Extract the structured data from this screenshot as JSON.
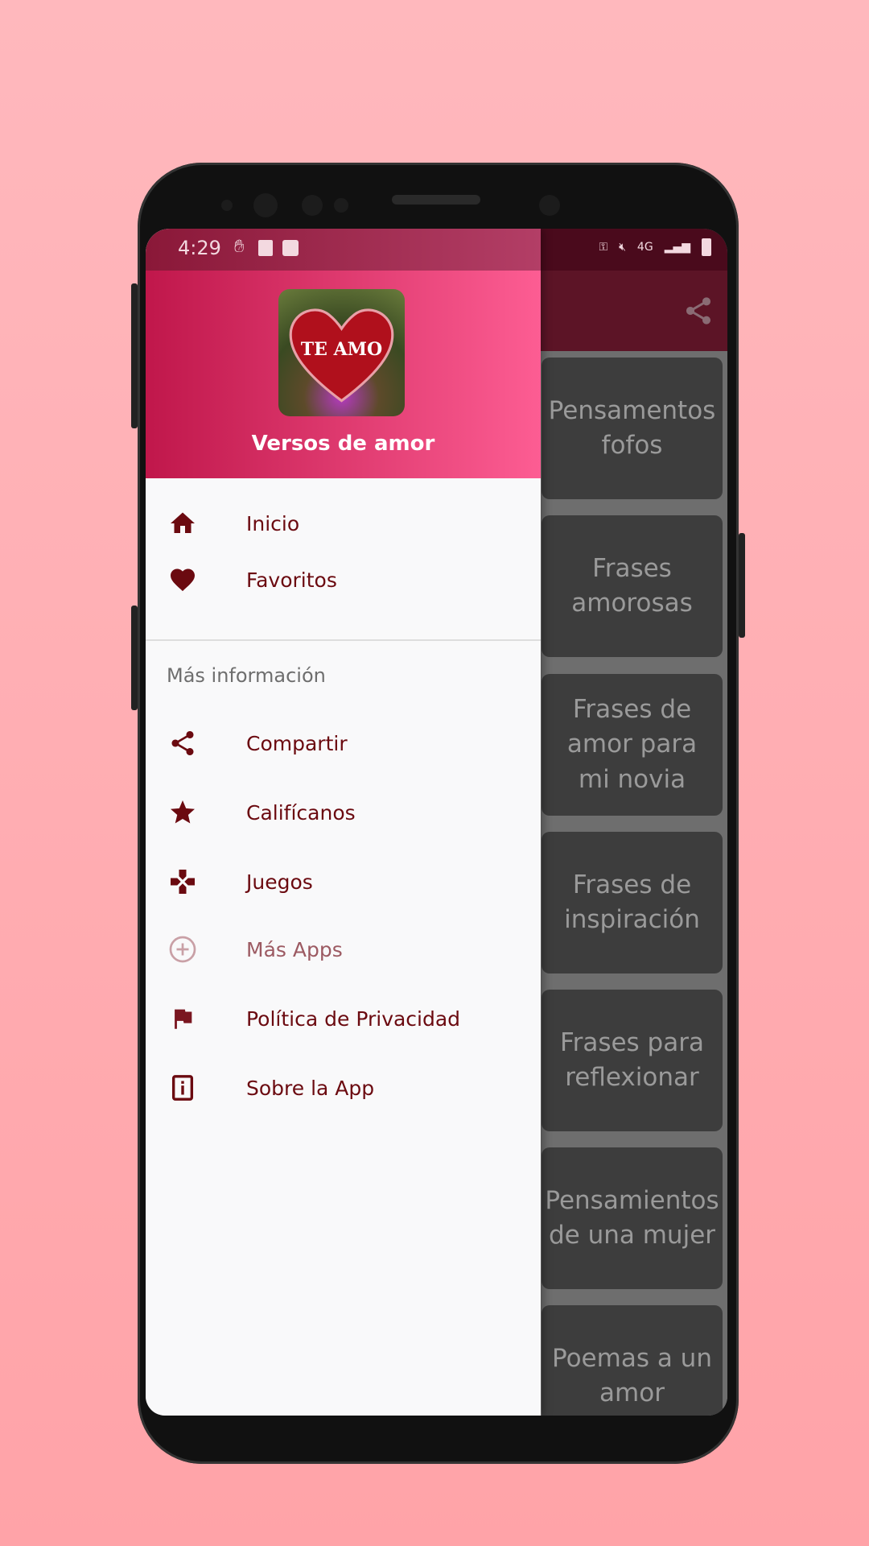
{
  "status_bar": {
    "time": "4:29",
    "network": "4G"
  },
  "app": {
    "name": "Versos de amor",
    "logo_text": "TE AMO"
  },
  "drawer": {
    "primary": [
      {
        "label": "Inicio",
        "icon": "home-icon"
      },
      {
        "label": "Favoritos",
        "icon": "heart-icon"
      }
    ],
    "section_title": "Más información",
    "secondary": [
      {
        "label": "Compartir",
        "icon": "share-icon"
      },
      {
        "label": "Califícanos",
        "icon": "star-icon"
      },
      {
        "label": "Juegos",
        "icon": "gamepad-icon"
      },
      {
        "label": "Más Apps",
        "icon": "plus-circle-icon"
      },
      {
        "label": "Política de Privacidad",
        "icon": "flag-icon"
      },
      {
        "label": "Sobre la App",
        "icon": "info-icon"
      }
    ]
  },
  "categories": [
    "Pensamentos fofos",
    "Frases amorosas",
    "Frases de amor para mi novia",
    "Frases de inspiración",
    "Frases para reflexionar",
    "Pensamientos de una mujer",
    "Poemas a un amor"
  ],
  "colors": {
    "accent": "#6b0a10",
    "header_start": "#c0174b",
    "header_end": "#fd5d93",
    "background": "#ffb8bd"
  }
}
